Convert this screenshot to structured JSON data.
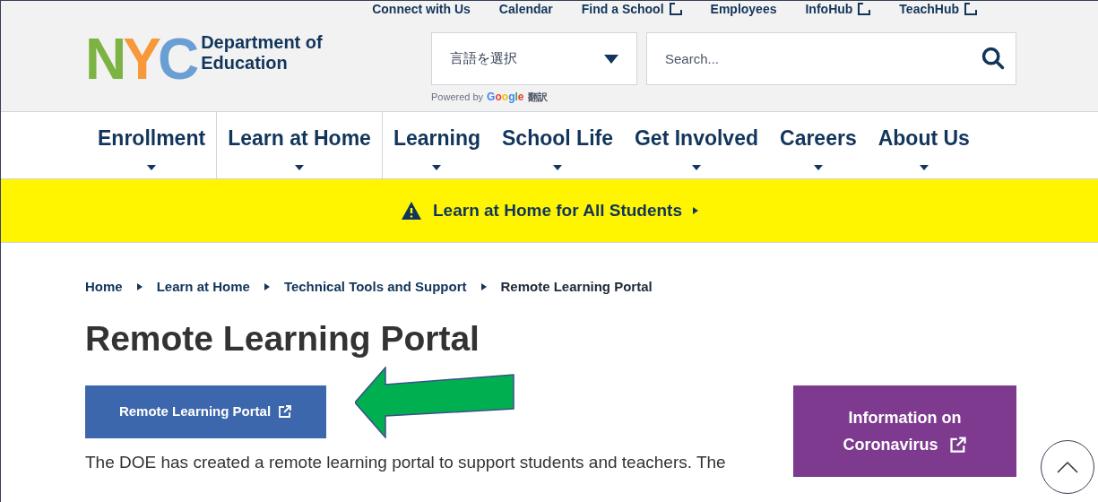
{
  "utility_links": [
    {
      "label": "Connect with Us",
      "external": false
    },
    {
      "label": "Calendar",
      "external": false
    },
    {
      "label": "Find a School",
      "external": true
    },
    {
      "label": "Employees",
      "external": false
    },
    {
      "label": "InfoHub",
      "external": true
    },
    {
      "label": "TeachHub",
      "external": true
    }
  ],
  "logo": {
    "letters": [
      {
        "text": "N",
        "color": "#7cb342"
      },
      {
        "text": "Y",
        "color": "#f7993a"
      },
      {
        "text": "C",
        "color": "#6a9fd4"
      }
    ],
    "name_lines": [
      "Department of",
      "Education"
    ]
  },
  "language_select": {
    "value": "言語を選択",
    "powered_by": "Powered by",
    "brand": "Google",
    "brand_suffix": "翻訳"
  },
  "search": {
    "placeholder": "Search..."
  },
  "nav": [
    {
      "label": "Enrollment",
      "divider": true
    },
    {
      "label": "Learn at Home",
      "divider": true
    },
    {
      "label": "Learning",
      "divider": false
    },
    {
      "label": "School Life",
      "divider": false
    },
    {
      "label": "Get Involved",
      "divider": false
    },
    {
      "label": "Careers",
      "divider": false
    },
    {
      "label": "About Us",
      "divider": false
    }
  ],
  "alert": {
    "text": "Learn at Home for All Students"
  },
  "breadcrumbs": [
    {
      "label": "Home",
      "current": false
    },
    {
      "label": "Learn at Home",
      "current": false
    },
    {
      "label": "Technical Tools and Support",
      "current": false
    },
    {
      "label": "Remote Learning Portal",
      "current": true
    }
  ],
  "title": "Remote Learning Portal",
  "portal_button": {
    "label": "Remote Learning Portal"
  },
  "info_button": {
    "lines": [
      "Information on",
      "Coronavirus"
    ]
  },
  "intro": "The DOE has created a remote learning portal to support students and teachers. The"
}
